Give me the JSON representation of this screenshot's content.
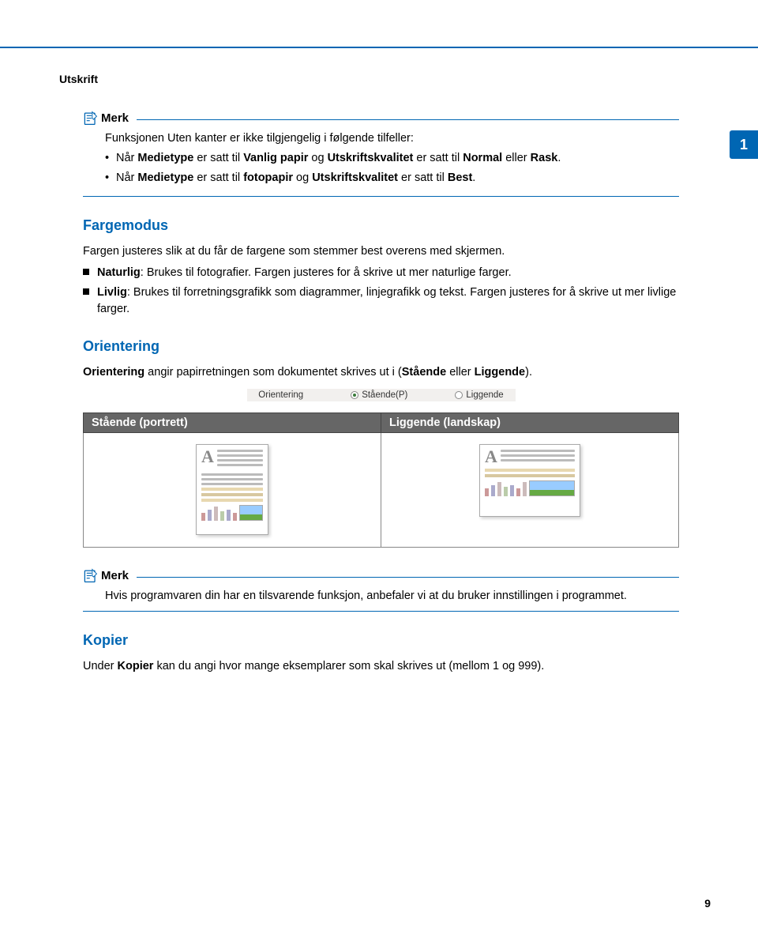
{
  "header": {
    "section": "Utskrift"
  },
  "sideTab": "1",
  "pageNumber": "9",
  "note1": {
    "label": "Merk",
    "intro": "Funksjonen Uten kanter er ikke tilgjengelig i følgende tilfeller:",
    "item1_pre": "Når ",
    "item1_b1": "Medietype",
    "item1_mid1": " er satt til ",
    "item1_b2": "Vanlig papir",
    "item1_mid2": " og ",
    "item1_b3": "Utskriftskvalitet",
    "item1_mid3": " er satt til ",
    "item1_b4": "Normal",
    "item1_mid4": " eller ",
    "item1_b5": "Rask",
    "item1_end": ".",
    "item2_pre": "Når ",
    "item2_b1": "Medietype",
    "item2_mid1": " er satt til ",
    "item2_b2": "fotopapir",
    "item2_mid2": " og ",
    "item2_b3": "Utskriftskvalitet",
    "item2_mid3": " er satt til ",
    "item2_b4": "Best",
    "item2_end": "."
  },
  "fargemodus": {
    "heading": "Fargemodus",
    "intro": "Fargen justeres slik at du får de fargene som stemmer best overens med skjermen.",
    "li1_b": "Naturlig",
    "li1_rest": ": Brukes til fotografier. Fargen justeres for å skrive ut mer naturlige farger.",
    "li2_b": "Livlig",
    "li2_rest": ": Brukes til forretningsgrafikk som diagrammer, linjegrafikk og tekst. Fargen justeres for å skrive ut mer livlige farger."
  },
  "orientering": {
    "heading": "Orientering",
    "intro_b1": "Orientering",
    "intro_mid": " angir papirretningen som dokumentet skrives ut i (",
    "intro_b2": "Stående",
    "intro_mid2": " eller ",
    "intro_b3": "Liggende",
    "intro_end": ").",
    "radio_label": "Orientering",
    "opt1": "Stående(P)",
    "opt2": "Liggende",
    "th1": "Stående (portrett)",
    "th2": "Liggende (landskap)"
  },
  "note2": {
    "label": "Merk",
    "text": "Hvis programvaren din har en tilsvarende funksjon, anbefaler vi at du bruker innstillingen i programmet."
  },
  "kopier": {
    "heading": "Kopier",
    "pre": "Under ",
    "b": "Kopier",
    "rest": " kan du angi hvor mange eksemplarer som skal skrives ut (mellom 1 og 999)."
  }
}
